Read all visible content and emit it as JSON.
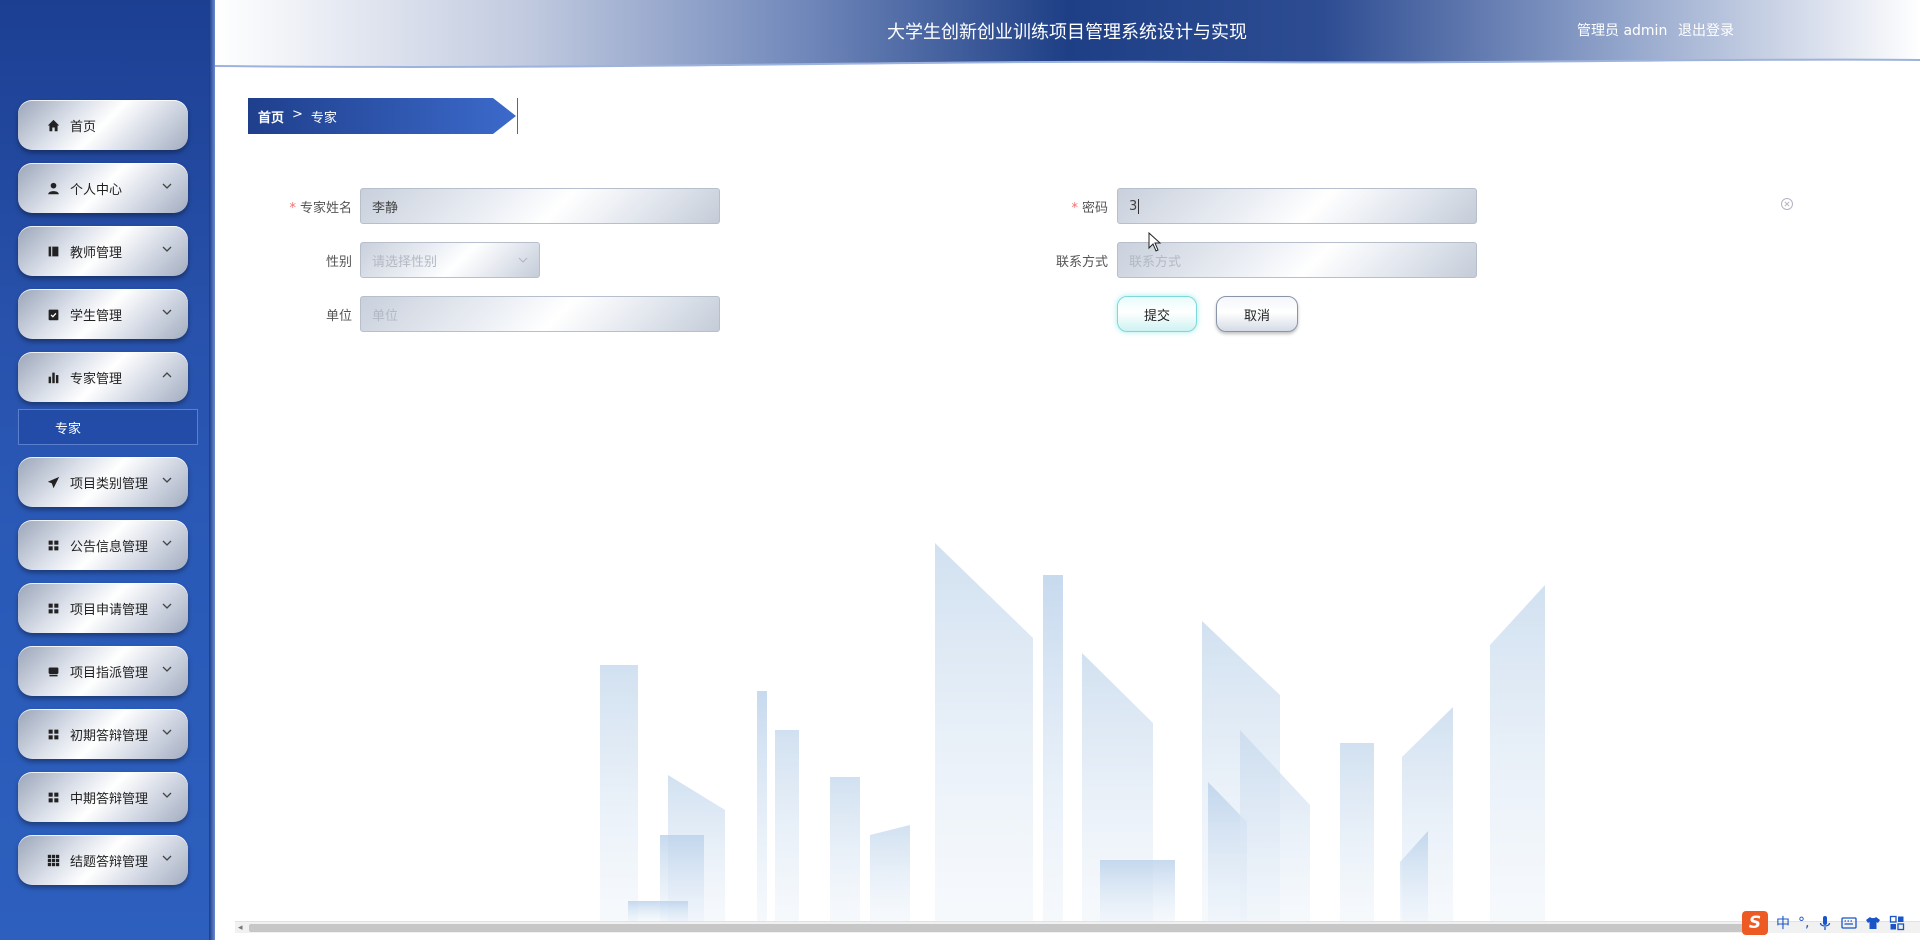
{
  "header": {
    "title": "大学生创新创业训练项目管理系统设计与实现",
    "user": "管理员 admin",
    "logout": "退出登录"
  },
  "sidebar": {
    "items": [
      {
        "label": "首页",
        "icon": "home-icon",
        "has_children": false
      },
      {
        "label": "个人中心",
        "icon": "user-icon",
        "has_children": true
      },
      {
        "label": "教师管理",
        "icon": "book-icon",
        "has_children": true
      },
      {
        "label": "学生管理",
        "icon": "clipboard-check-icon",
        "has_children": true
      },
      {
        "label": "专家管理",
        "icon": "bar-chart-icon",
        "has_children": true,
        "expanded": true
      },
      {
        "label": "项目类别管理",
        "icon": "send-icon",
        "has_children": true
      },
      {
        "label": "公告信息管理",
        "icon": "grid-icon",
        "has_children": true
      },
      {
        "label": "项目申请管理",
        "icon": "grid-icon",
        "has_children": true
      },
      {
        "label": "项目指派管理",
        "icon": "inbox-icon",
        "has_children": true
      },
      {
        "label": "初期答辩管理",
        "icon": "grid-icon",
        "has_children": true
      },
      {
        "label": "中期答辩管理",
        "icon": "grid-icon",
        "has_children": true
      },
      {
        "label": "结题答辩管理",
        "icon": "apps-icon",
        "has_children": true
      }
    ],
    "sub_item": "专家"
  },
  "breadcrumb": {
    "home": "首页",
    "separator": ">",
    "current": "专家"
  },
  "form": {
    "name_label": "专家姓名",
    "name_value": "李静",
    "password_label": "密码",
    "password_value": "3",
    "gender_label": "性别",
    "gender_placeholder": "请选择性别",
    "contact_label": "联系方式",
    "contact_placeholder": "联系方式",
    "unit_label": "单位",
    "unit_placeholder": "单位",
    "submit": "提交",
    "cancel": "取消"
  },
  "ime": {
    "lang": "中",
    "punct": "°,"
  },
  "colors": {
    "sidebar": "#2852ac",
    "header_dark": "#1e3f86",
    "breadcrumb": "#2a56b4",
    "required": "#f56c6c"
  }
}
